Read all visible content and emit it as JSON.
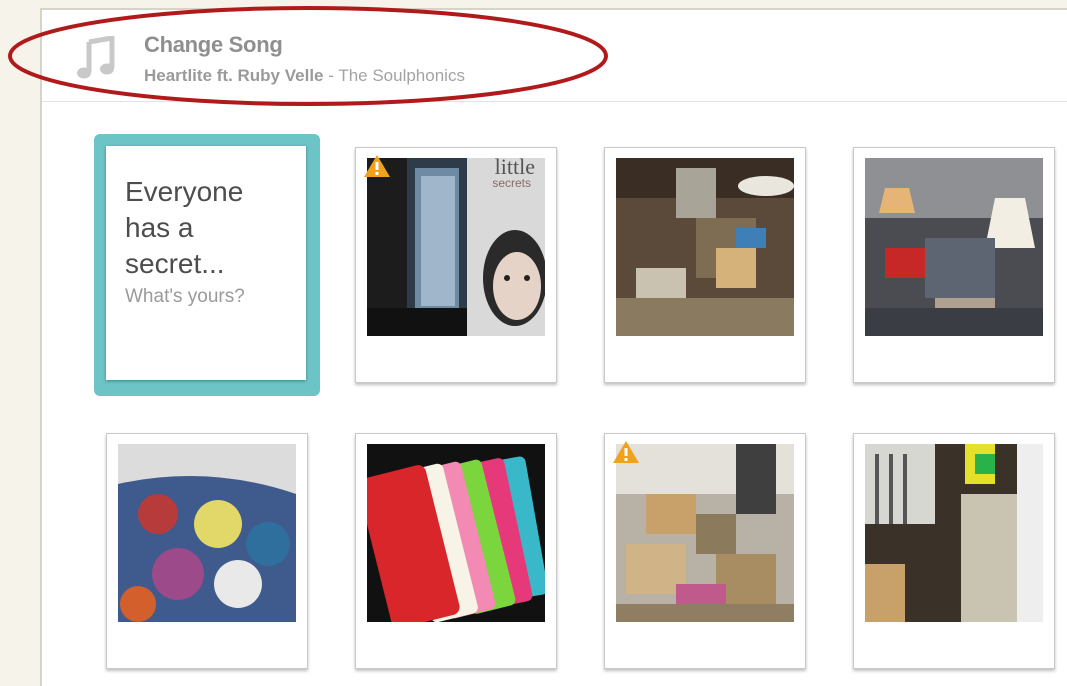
{
  "song_bar": {
    "icon": "music-note-icon",
    "title": "Change Song",
    "track": "Heartlite ft. Ruby Velle",
    "separator": " - ",
    "artist": "The Soulphonics"
  },
  "prompt_card": {
    "main_text": "Everyone has a secret...",
    "sub_text": "What's yours?",
    "accent_color": "#6cc4c6"
  },
  "album_art": {
    "title_line1": "little",
    "title_line2": "secrets"
  },
  "photos": [
    {
      "label": "album-cover-little-secrets",
      "warning": true
    },
    {
      "label": "cluttered-room-1",
      "warning": false
    },
    {
      "label": "cluttered-room-lamps",
      "warning": false
    },
    {
      "label": "clothes-pile",
      "warning": false
    },
    {
      "label": "colorful-cases",
      "warning": false
    },
    {
      "label": "cluttered-room-boxes",
      "warning": true
    },
    {
      "label": "stacked-newspapers-stairs",
      "warning": false
    }
  ],
  "colors": {
    "highlight": "#b11a1a",
    "warning": "#f0a21c"
  }
}
